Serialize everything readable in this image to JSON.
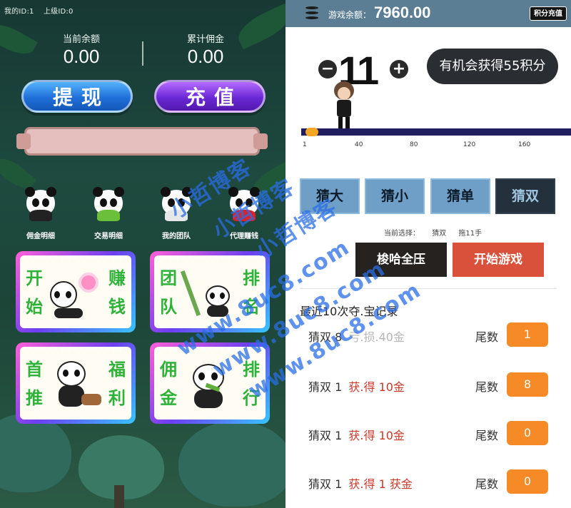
{
  "left": {
    "ids": {
      "my_id": "我的ID:1",
      "parent_id": "上级ID:0"
    },
    "balance": {
      "label": "当前余额",
      "value": "0.00"
    },
    "commission": {
      "label": "累计佣金",
      "value": "0.00"
    },
    "buttons": {
      "withdraw": "提现",
      "recharge": "充值"
    },
    "quick_links": [
      {
        "label": "佣金明细",
        "icon": "panda-icon"
      },
      {
        "label": "交易明细",
        "icon": "panda-icon"
      },
      {
        "label": "我的团队",
        "icon": "panda-team-icon"
      },
      {
        "label": "代理赚钱",
        "icon": "panda-icon"
      }
    ],
    "cards": [
      {
        "left": [
          "开",
          "始"
        ],
        "right": [
          "赚",
          "钱"
        ]
      },
      {
        "left": [
          "团",
          "队"
        ],
        "right": [
          "排",
          "名"
        ]
      },
      {
        "left": [
          "首",
          "推"
        ],
        "right": [
          "福",
          "利"
        ]
      },
      {
        "left": [
          "佣",
          "金"
        ],
        "right": [
          "排",
          "行"
        ]
      }
    ]
  },
  "right": {
    "top_bar": {
      "label": "游戏余额：",
      "value": "7960.00",
      "points_button": "积分充值"
    },
    "bet": {
      "minus": "−",
      "value": "11",
      "plus": "+"
    },
    "chance": "有机会获得55积分",
    "ticks": [
      "1",
      "40",
      "80",
      "120",
      "160"
    ],
    "slider": {
      "value": 11,
      "min": 1,
      "max": 160
    },
    "guess_buttons": [
      {
        "label": "猜大",
        "active": false
      },
      {
        "label": "猜小",
        "active": false
      },
      {
        "label": "猜单",
        "active": false
      },
      {
        "label": "猜双",
        "active": true
      }
    ],
    "selection": {
      "label": "当前选择：",
      "choice": "猜双",
      "hands": "拖11手"
    },
    "actions": {
      "all_in": "梭哈全压",
      "start": "开始游戏"
    },
    "records_title": "最近10次夺.宝记录",
    "records": [
      {
        "guess": "猜双",
        "amount": "8",
        "result": "亏.损.40金",
        "kind": "lose",
        "tail_label": "尾数",
        "tail": "1"
      },
      {
        "guess": "猜双",
        "amount": "1",
        "result": "获.得 10金",
        "kind": "win",
        "tail_label": "尾数",
        "tail": "8"
      },
      {
        "guess": "猜双",
        "amount": "1",
        "result": "获.得 10金",
        "kind": "win",
        "tail_label": "尾数",
        "tail": "0"
      },
      {
        "guess": "猜双",
        "amount": "1",
        "result": "获.得 1 获金",
        "kind": "win",
        "tail_label": "尾数",
        "tail": "0"
      }
    ]
  },
  "watermark": {
    "lines": [
      "小哲博客",
      "小哲博客",
      "小哲博客",
      "www.8uc8.com",
      "www.8uc8.com",
      "www.8uc8.com"
    ]
  },
  "colors": {
    "accent_blue": "#5b7e95",
    "guess_blue": "#6f9fc6",
    "start_red": "#d9513b",
    "badge_orange": "#f58a26",
    "win_red": "#c93a2b"
  }
}
